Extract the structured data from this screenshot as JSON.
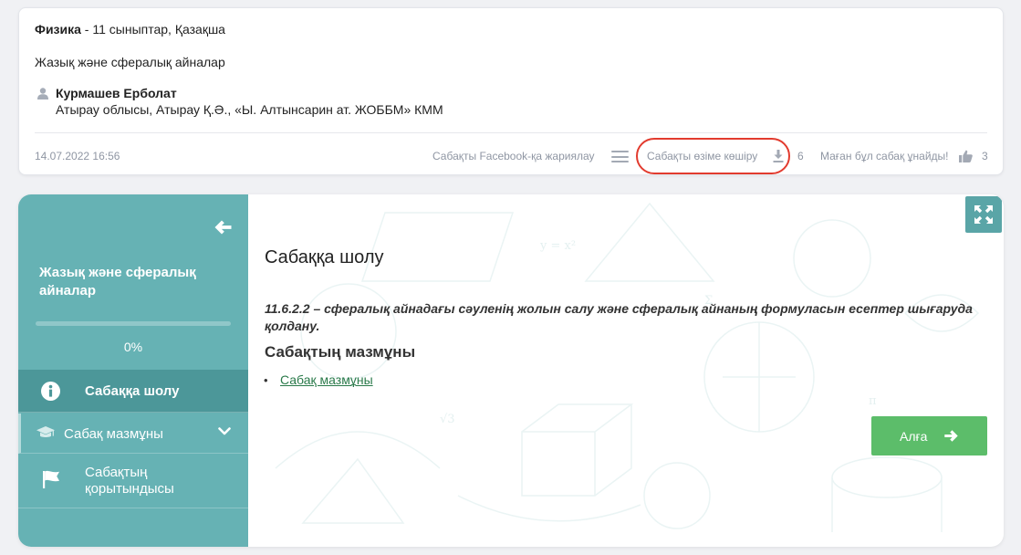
{
  "info_card": {
    "subject": "Физика",
    "subject_suffix": " - 11 сыныптар, Қазақша",
    "lesson_title": "Жазық және сфералық айналар",
    "author_name": "Курмашев Ерболат",
    "author_org": "Атырау облысы, Атырау Қ.Ә., «Ы. Алтынсарин ат. ЖОББМ» КММ",
    "date": "14.07.2022 16:56",
    "share_facebook_label": "Сабақты Facebook-қа жариялау",
    "copy_label": "Сабақты өзіме көшіру",
    "copy_count": "6",
    "like_label": "Маған бұл сабақ ұнайды!",
    "like_count": "3",
    "highlight_color": "#e23b2e"
  },
  "sidebar": {
    "title": "Жазық және сфералық айналар",
    "progress_percent": 0,
    "progress_text": "0%",
    "items": [
      {
        "label": "Сабаққа шолу",
        "icon": "info-icon",
        "active": true
      },
      {
        "label": "Сабақ мазмұны",
        "icon": "graduation-cap-icon",
        "expandable": true
      },
      {
        "label": "Сабақтың қорытындысы",
        "icon": "flag-icon"
      }
    ],
    "color": "#66b2b4"
  },
  "content": {
    "heading": "Сабаққа шолу",
    "objective": "11.6.2.2 – сфералық айнадағы сәуленің жолын салу және сфералық айнаның формуласын есептер шығаруда қолдану.",
    "section_title": "Сабақтың мазмұны",
    "bullet": "•",
    "link_label": "Сабақ мазмұны",
    "next_label": "Алға",
    "next_color": "#5cbd6a"
  }
}
